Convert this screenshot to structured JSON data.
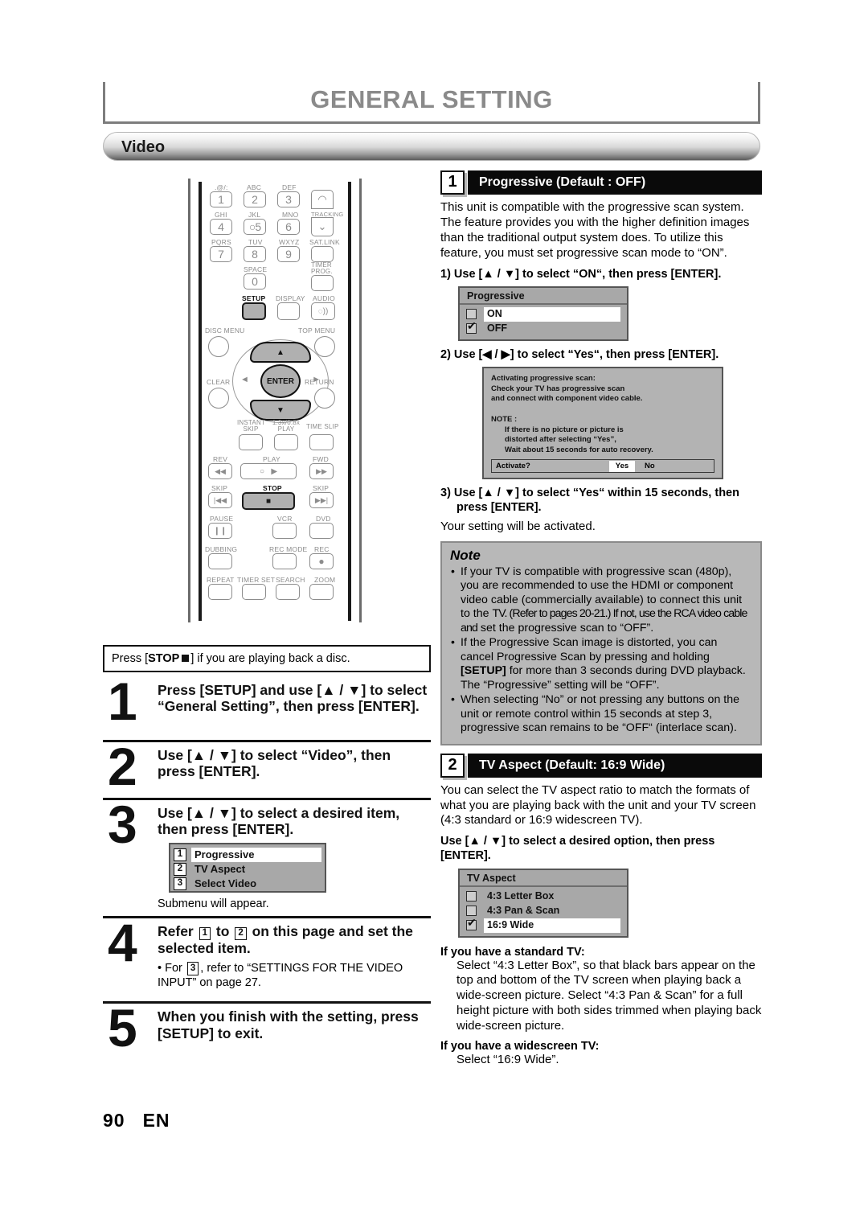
{
  "header": {
    "title": "GENERAL SETTING",
    "section_bar": "Video"
  },
  "remote": {
    "key_labels_top": [
      ".@/:",
      "ABC",
      "DEF",
      "GHI",
      "JKL",
      "MNO",
      "PQRS",
      "TUV",
      "WXYZ",
      "SPACE"
    ],
    "number_keys": [
      "1",
      "2",
      "3",
      "4",
      "5",
      "6",
      "7",
      "8",
      "9",
      "0"
    ],
    "tracking": "TRACKING",
    "sat_link": "SAT.LINK",
    "timer_prog": "TIMER PROG.",
    "setup": "SETUP",
    "display": "DISPLAY",
    "audio": "AUDIO",
    "disc_menu": "DISC MENU",
    "top_menu": "TOP MENU",
    "clear": "CLEAR",
    "return": "RETURN",
    "enter": "ENTER",
    "instant_skip": "INSTANT SKIP",
    "speed_play": "1.3x/0.8x PLAY",
    "time_slip": "TIME SLIP",
    "rev": "REV",
    "play": "PLAY",
    "fwd": "FWD",
    "skip_back": "SKIP",
    "stop": "STOP",
    "skip_fwd": "SKIP",
    "pause": "PAUSE",
    "vcr": "VCR",
    "dvd": "DVD",
    "dubbing": "DUBBING",
    "rec_mode": "REC MODE",
    "rec": "REC",
    "repeat": "REPEAT",
    "timer_set": "TIMER SET",
    "search": "SEARCH",
    "zoom": "ZOOM"
  },
  "left": {
    "press_stop_pre": "Press [",
    "press_stop_bold": "STOP",
    "press_stop_post": "] if you are playing back a disc.",
    "steps": [
      {
        "num": "1",
        "head": "Press [SETUP] and use [▲ / ▼] to select “General Setting”, then press [ENTER]."
      },
      {
        "num": "2",
        "head": "Use [▲ / ▼] to select “Video”, then press [ENTER]."
      },
      {
        "num": "3",
        "head": "Use [▲ / ▼] to select a desired item, then press [ENTER].",
        "sub": "Submenu will appear."
      },
      {
        "num": "4",
        "head_a": "Refer",
        "head_b": "to",
        "head_c": "on this page and set the selected item.",
        "ref1": "1",
        "ref2": "2",
        "sub_a": "• For",
        "ref3": "3",
        "sub_b": ", refer to “SETTINGS FOR THE VIDEO INPUT” on page 27."
      },
      {
        "num": "5",
        "head": "When you finish with the setting, press [SETUP] to exit."
      }
    ],
    "submenu": {
      "items": [
        {
          "n": "1",
          "label": "Progressive",
          "selected": true
        },
        {
          "n": "2",
          "label": "TV Aspect",
          "selected": false
        },
        {
          "n": "3",
          "label": "Select Video",
          "selected": false
        }
      ]
    }
  },
  "right": {
    "progressive": {
      "tag": "1",
      "title": "Progressive (Default : OFF)",
      "intro": "This unit is compatible with the progressive scan system. The feature provides you with the higher definition images than the traditional output system does. To utilize this feature, you must set progressive scan mode to “ON”.",
      "step1": "1) Use [▲ / ▼] to select “ON“, then press [ENTER].",
      "osd": {
        "title": "Progressive",
        "options": [
          {
            "label": "ON",
            "checked": false,
            "selected": true
          },
          {
            "label": "OFF",
            "checked": true,
            "selected": false
          }
        ]
      },
      "step2": "2) Use [◀ / ▶] to select “Yes“, then press [ENTER].",
      "dialog": {
        "line1": "Activating progressive scan:",
        "line2": "Check your TV has progressive scan",
        "line3": "and connect with component video cable.",
        "note_head": "NOTE :",
        "note1": "If there is no picture or picture is",
        "note2": "distorted after selecting “Yes”,",
        "note3": "Wait about 15 seconds for auto recovery.",
        "activate_q": "Activate?",
        "yes": "Yes",
        "no": "No"
      },
      "step3_a": "3) Use [▲ / ▼] to select “Yes“ within 15 seconds, then",
      "step3_b": "press [ENTER].",
      "step3_sub": "Your setting will be activated."
    },
    "note": {
      "title": "Note",
      "items": [
        {
          "a": "If your TV is compatible with progressive scan (480p), you are recommended to use the HDMI or component video cable (commercially available) to connect this unit to the ",
          "squeeze": "TV. (Refer to pages 20-21.) If not, use the RCA video cable and",
          "b": " set the progressive scan to “OFF”."
        },
        {
          "a": "If the Progressive Scan image is distorted, you can cancel Progressive Scan by pressing and holding ",
          "bold": "[SETUP]",
          "b": " for more than 3 seconds during DVD playback. The “Progressive” setting will be “OFF”."
        },
        {
          "a": "When selecting “No” or not pressing any buttons on the unit or remote control within 15 seconds at step 3, progressive scan remains to be “OFF“ (interlace scan)."
        }
      ]
    },
    "tv_aspect": {
      "tag": "2",
      "title": "TV Aspect (Default: 16:9 Wide)",
      "intro": "You can select the TV aspect ratio to match the formats of what you are playing back with the unit and your TV screen (4:3 standard or 16:9 widescreen TV).",
      "use_line": "Use [▲ / ▼] to select a desired option, then press [ENTER].",
      "osd": {
        "title": "TV Aspect",
        "options": [
          {
            "label": "4:3 Letter Box",
            "checked": false,
            "selected": false
          },
          {
            "label": "4:3 Pan & Scan",
            "checked": false,
            "selected": false
          },
          {
            "label": "16:9 Wide",
            "checked": true,
            "selected": true
          }
        ]
      },
      "standard_head": "If you have a standard TV:",
      "standard_body": "Select “4:3 Letter Box”, so that black bars appear on the top and bottom of the TV screen when playing back a wide-screen picture. Select “4:3 Pan & Scan” for a full height picture with both sides trimmed when playing back wide-screen picture.",
      "wide_head": "If you have a widescreen TV:",
      "wide_body": "Select “16:9 Wide”."
    }
  },
  "footer": {
    "page": "90",
    "lang": "EN"
  }
}
